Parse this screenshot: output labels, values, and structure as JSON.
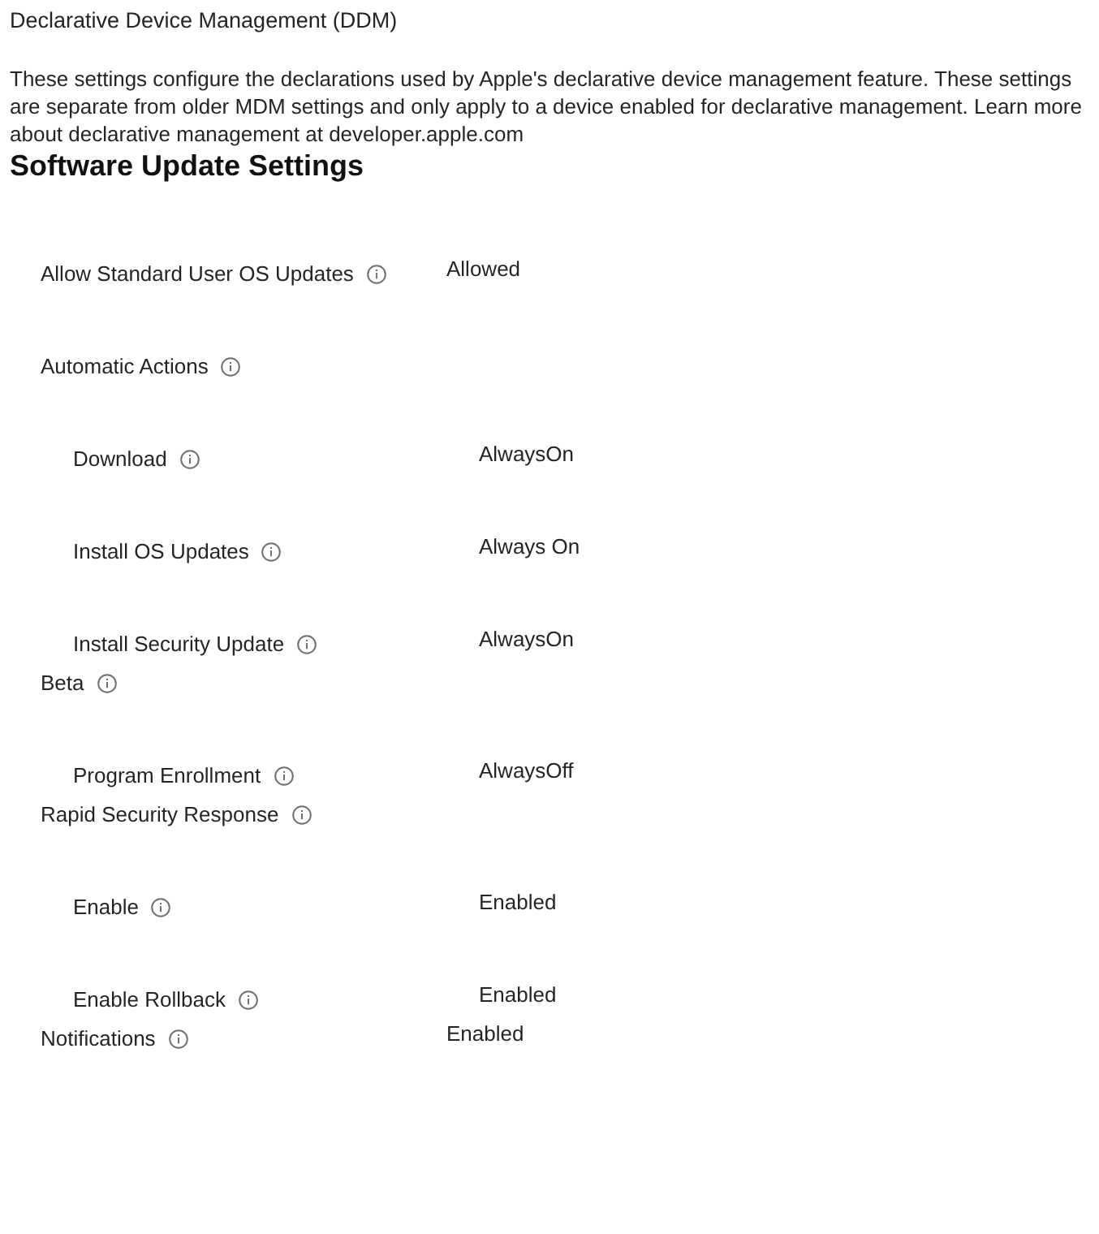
{
  "header": {
    "title": "Declarative Device Management (DDM)",
    "description": "These settings configure the declarations used by Apple's declarative device management feature. These settings are separate from older MDM settings and only apply to a device enabled for declarative management. Learn more about declarative management at developer.apple.com"
  },
  "section": {
    "title": "Software Update Settings",
    "settings": [
      {
        "label": "Allow Standard User OS Updates",
        "value": "Allowed"
      },
      {
        "label": "Automatic Actions",
        "children": [
          {
            "label": "Download",
            "value": "AlwaysOn"
          },
          {
            "label": "Install OS Updates",
            "value": "Always On"
          },
          {
            "label": "Install Security Update",
            "value": "AlwaysOn"
          }
        ]
      },
      {
        "label": "Beta",
        "children": [
          {
            "label": "Program Enrollment",
            "value": "AlwaysOff"
          }
        ]
      },
      {
        "label": "Rapid Security Response",
        "children": [
          {
            "label": "Enable",
            "value": "Enabled"
          },
          {
            "label": "Enable Rollback",
            "value": "Enabled"
          }
        ]
      },
      {
        "label": "Notifications",
        "value": "Enabled"
      }
    ]
  }
}
